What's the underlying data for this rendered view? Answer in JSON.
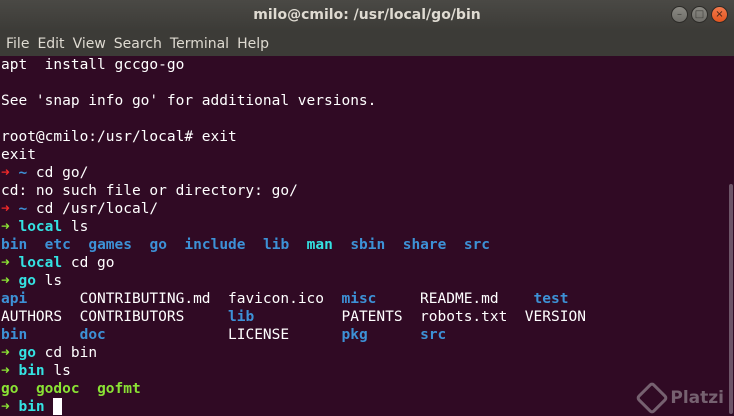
{
  "window": {
    "title": "milo@cmilo: /usr/local/go/bin",
    "buttons": {
      "minimize": "–",
      "maximize": "□",
      "close": "×"
    }
  },
  "menubar": {
    "items": [
      "File",
      "Edit",
      "View",
      "Search",
      "Terminal",
      "Help"
    ]
  },
  "colors": {
    "background": "#300a24",
    "text": "#ffffff",
    "dir_blue": "#3d91d6",
    "link_cyan": "#34e2e2",
    "green": "#8ae234",
    "red": "#ef2929",
    "exec_green": "#8ae234"
  },
  "terminal": {
    "lines": [
      [
        {
          "t": "apt  install gccgo-go",
          "c": "text"
        }
      ],
      [],
      [
        {
          "t": "See 'snap info go' for additional versions.",
          "c": "text"
        }
      ],
      [],
      [
        {
          "t": "root@cmilo:/usr/local# exit",
          "c": "text"
        }
      ],
      [
        {
          "t": "exit",
          "c": "text"
        }
      ],
      [
        {
          "t": "➜ ",
          "c": "red",
          "b": true
        },
        {
          "t": "~",
          "c": "dir_blue",
          "b": true
        },
        {
          "t": " cd go/",
          "c": "text"
        }
      ],
      [
        {
          "t": "cd: no such file or directory: go/",
          "c": "text"
        }
      ],
      [
        {
          "t": "➜ ",
          "c": "red",
          "b": true
        },
        {
          "t": "~",
          "c": "dir_blue",
          "b": true
        },
        {
          "t": " cd /usr/local/",
          "c": "text"
        }
      ],
      [
        {
          "t": "➜ ",
          "c": "green",
          "b": true
        },
        {
          "t": "local",
          "c": "link_cyan",
          "b": true
        },
        {
          "t": " ls",
          "c": "text"
        }
      ],
      [
        {
          "t": "bin",
          "c": "dir_blue",
          "b": true
        },
        {
          "t": "  ",
          "c": "text"
        },
        {
          "t": "etc",
          "c": "dir_blue",
          "b": true
        },
        {
          "t": "  ",
          "c": "text"
        },
        {
          "t": "games",
          "c": "dir_blue",
          "b": true
        },
        {
          "t": "  ",
          "c": "text"
        },
        {
          "t": "go",
          "c": "dir_blue",
          "b": true
        },
        {
          "t": "  ",
          "c": "text"
        },
        {
          "t": "include",
          "c": "dir_blue",
          "b": true
        },
        {
          "t": "  ",
          "c": "text"
        },
        {
          "t": "lib",
          "c": "dir_blue",
          "b": true
        },
        {
          "t": "  ",
          "c": "text"
        },
        {
          "t": "man",
          "c": "link_cyan",
          "b": true
        },
        {
          "t": "  ",
          "c": "text"
        },
        {
          "t": "sbin",
          "c": "dir_blue",
          "b": true
        },
        {
          "t": "  ",
          "c": "text"
        },
        {
          "t": "share",
          "c": "dir_blue",
          "b": true
        },
        {
          "t": "  ",
          "c": "text"
        },
        {
          "t": "src",
          "c": "dir_blue",
          "b": true
        }
      ],
      [
        {
          "t": "➜ ",
          "c": "green",
          "b": true
        },
        {
          "t": "local",
          "c": "link_cyan",
          "b": true
        },
        {
          "t": " cd go",
          "c": "text"
        }
      ],
      [
        {
          "t": "➜ ",
          "c": "green",
          "b": true
        },
        {
          "t": "go",
          "c": "link_cyan",
          "b": true
        },
        {
          "t": " ls",
          "c": "text"
        }
      ],
      [
        {
          "t": "api",
          "c": "dir_blue",
          "b": true
        },
        {
          "t": "      CONTRIBUTING.md  favicon.ico  ",
          "c": "text"
        },
        {
          "t": "misc",
          "c": "dir_blue",
          "b": true
        },
        {
          "t": "     README.md    ",
          "c": "text"
        },
        {
          "t": "test",
          "c": "dir_blue",
          "b": true
        }
      ],
      [
        {
          "t": "AUTHORS  CONTRIBUTORS     ",
          "c": "text"
        },
        {
          "t": "lib",
          "c": "dir_blue",
          "b": true
        },
        {
          "t": "          PATENTS  robots.txt  VERSION",
          "c": "text"
        }
      ],
      [
        {
          "t": "bin",
          "c": "dir_blue",
          "b": true
        },
        {
          "t": "      ",
          "c": "text"
        },
        {
          "t": "doc",
          "c": "dir_blue",
          "b": true
        },
        {
          "t": "              LICENSE      ",
          "c": "text"
        },
        {
          "t": "pkg",
          "c": "dir_blue",
          "b": true
        },
        {
          "t": "      ",
          "c": "text"
        },
        {
          "t": "src",
          "c": "dir_blue",
          "b": true
        }
      ],
      [
        {
          "t": "➜ ",
          "c": "green",
          "b": true
        },
        {
          "t": "go",
          "c": "link_cyan",
          "b": true
        },
        {
          "t": " cd bin",
          "c": "text"
        }
      ],
      [
        {
          "t": "➜ ",
          "c": "green",
          "b": true
        },
        {
          "t": "bin",
          "c": "link_cyan",
          "b": true
        },
        {
          "t": " ls",
          "c": "text"
        }
      ],
      [
        {
          "t": "go",
          "c": "exec_green",
          "b": true
        },
        {
          "t": "  ",
          "c": "text"
        },
        {
          "t": "godoc",
          "c": "exec_green",
          "b": true
        },
        {
          "t": "  ",
          "c": "text"
        },
        {
          "t": "gofmt",
          "c": "exec_green",
          "b": true
        }
      ],
      [
        {
          "t": "➜ ",
          "c": "green",
          "b": true
        },
        {
          "t": "bin",
          "c": "link_cyan",
          "b": true
        },
        {
          "t": " ",
          "c": "text"
        }
      ]
    ],
    "cursor_line_index": 19
  },
  "watermark": {
    "text": "Platzi",
    "icon": "platzi-logo-icon"
  }
}
